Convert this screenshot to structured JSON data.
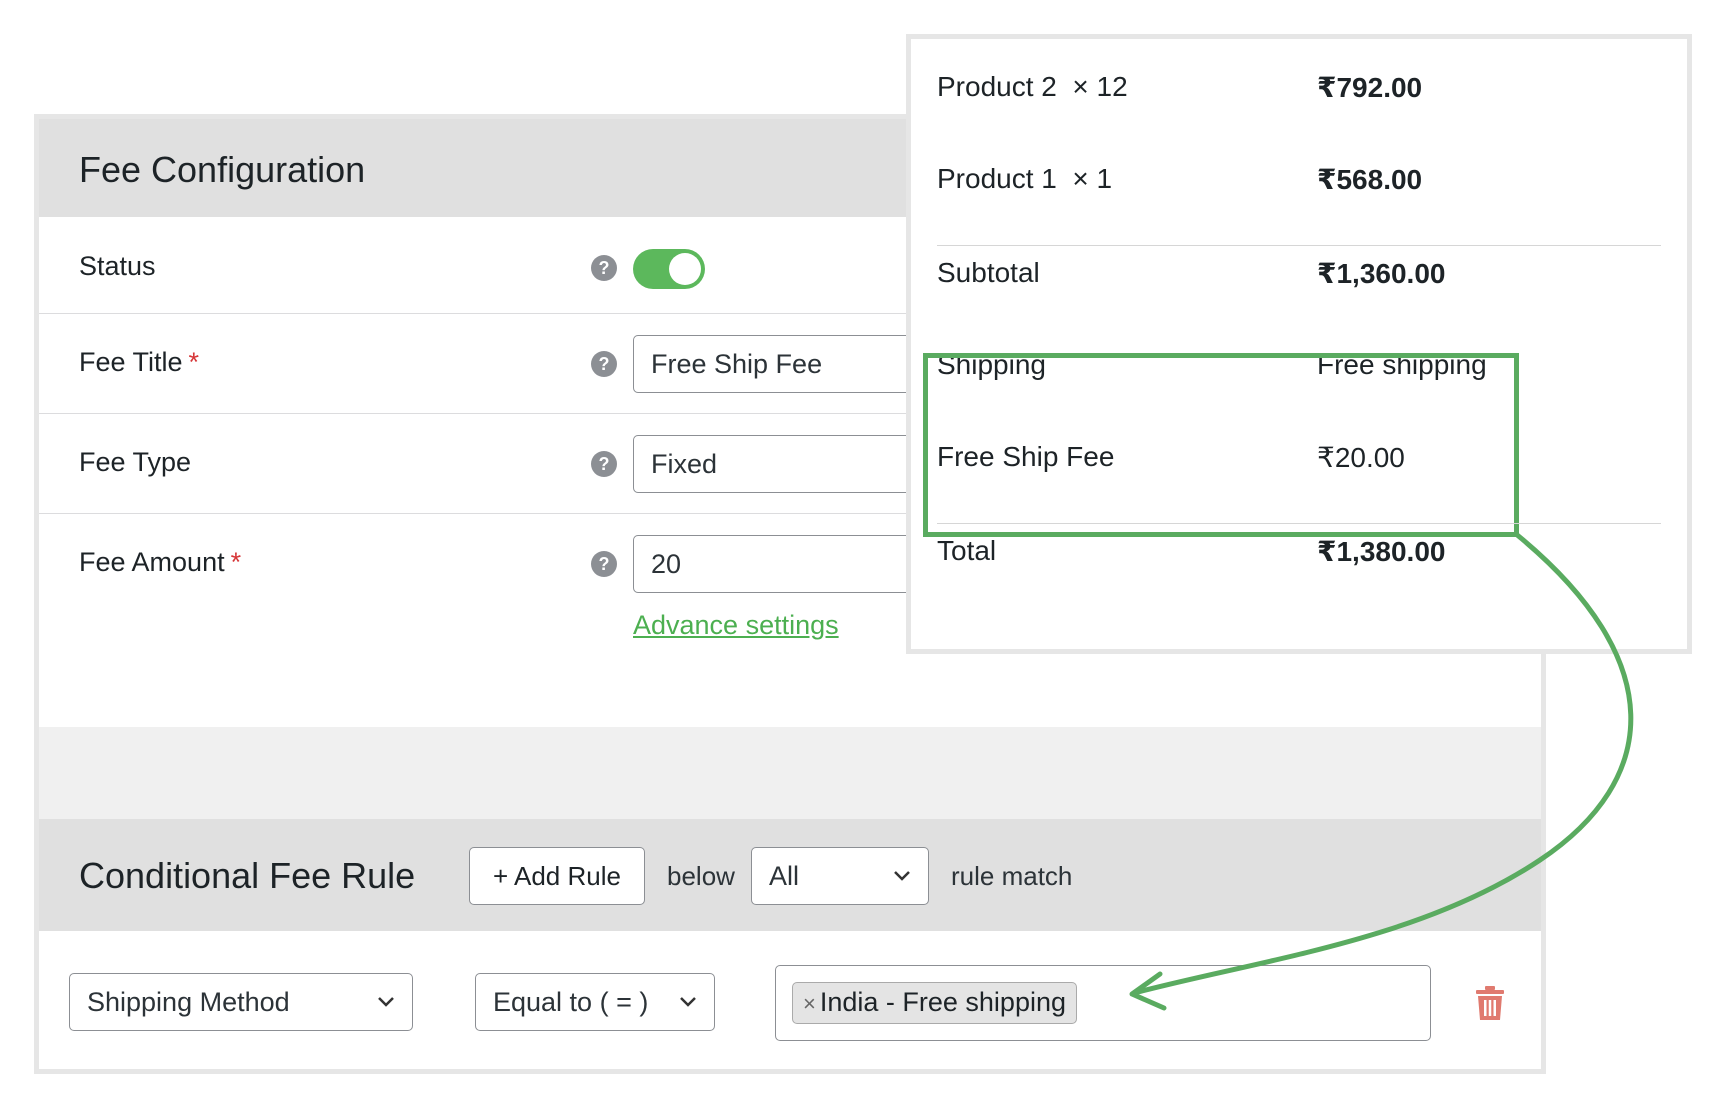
{
  "fee_config": {
    "title": "Fee Configuration",
    "fields": {
      "status": {
        "label": "Status",
        "enabled": true
      },
      "fee_title": {
        "label": "Fee Title",
        "required_mark": "*",
        "value": "Free Ship Fee"
      },
      "fee_type": {
        "label": "Fee Type",
        "value": "Fixed"
      },
      "fee_amount": {
        "label": "Fee Amount",
        "required_mark": "*",
        "value": "20"
      }
    },
    "help_icon": "?",
    "advance_settings_link": "Advance settings"
  },
  "conditional_rule": {
    "title": "Conditional Fee Rule",
    "add_rule_button": "+ Add Rule",
    "below_text": "below",
    "match_select": "All",
    "rule_match_text": "rule match",
    "condition": {
      "field_select": "Shipping Method",
      "operator_select": "Equal to ( = )",
      "value_tag": "India - Free shipping",
      "tag_remove": "×"
    }
  },
  "cart": {
    "items": [
      {
        "name": "Product 2",
        "qty": "× 12",
        "price": "₹792.00"
      },
      {
        "name": "Product 1",
        "qty": "× 1",
        "price": "₹568.00"
      }
    ],
    "subtotal": {
      "label": "Subtotal",
      "value": "₹1,360.00"
    },
    "shipping": {
      "label": "Shipping",
      "value": "Free shipping"
    },
    "fee": {
      "label": "Free Ship Fee",
      "value": "₹20.00"
    },
    "total": {
      "label": "Total",
      "value": "₹1,380.00"
    }
  },
  "colors": {
    "accent_green": "#5aab60",
    "toggle_on": "#5cb85c",
    "required_red": "#d63638",
    "trash_red": "#e07a6f"
  },
  "icons": [
    "help-icon",
    "chevron-down-icon",
    "trash-icon",
    "arrow-connector"
  ]
}
